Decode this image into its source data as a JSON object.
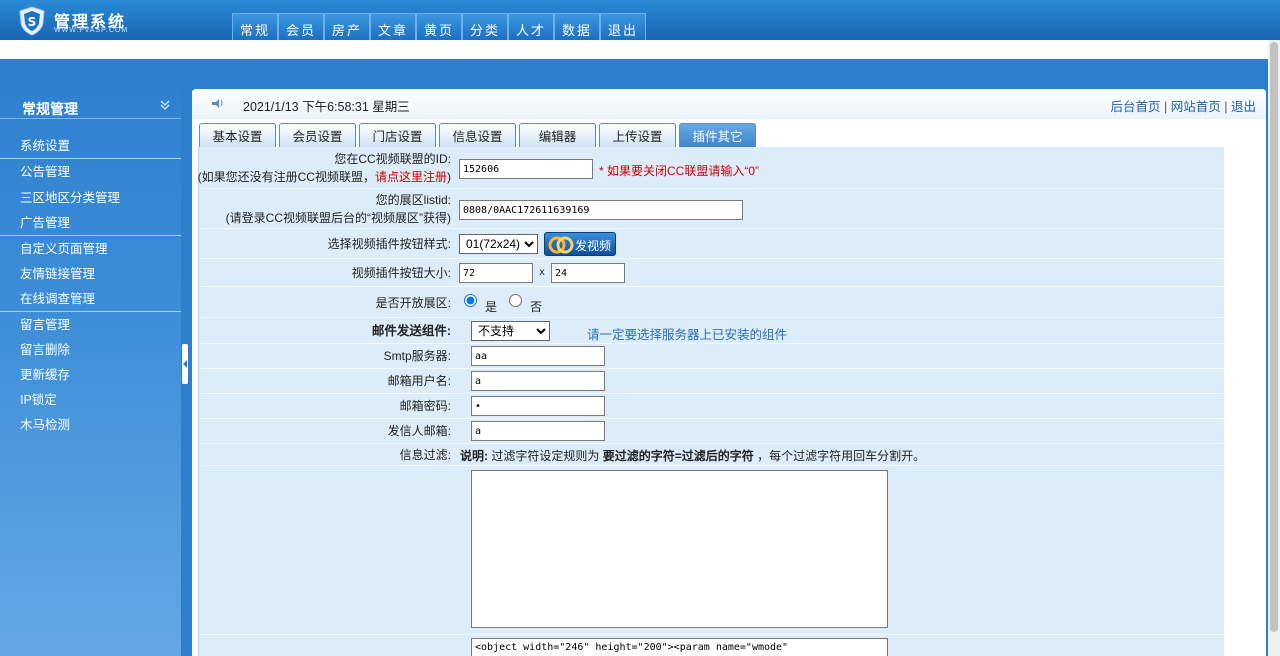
{
  "header": {
    "logo_title": "管理系统",
    "logo_subtitle": "WWW.FVASP.COM",
    "nav": [
      "常规",
      "会员",
      "房产",
      "文章",
      "黄页",
      "分类",
      "人才",
      "数据",
      "退出"
    ]
  },
  "sidebar": {
    "title": "常规管理",
    "items": [
      "系统设置",
      "公告管理",
      "三区地区分类管理",
      "广告管理",
      "自定义页面管理",
      "友情链接管理",
      "在线调查管理",
      "留言管理",
      "留言删除",
      "更新缓存",
      "IP锁定",
      "木马检测"
    ]
  },
  "main": {
    "datetime": "2021/1/13 下午6:58:31 星期三",
    "links": {
      "admin_home": "后台首页",
      "site_home": "网站首页",
      "logout": "退出",
      "sep": "|"
    },
    "tabs": [
      "基本设置",
      "会员设置",
      "门店设置",
      "信息设置",
      "编辑器",
      "上传设置",
      "插件其它"
    ],
    "active_tab": 6
  },
  "form": {
    "cc_id": {
      "label1": "您在CC视频联盟的ID:",
      "label2_pre": "(如果您还没有注册CC视频联盟，",
      "label2_link": "请点这里注册",
      "label2_post": ")",
      "value": "152606",
      "note": "* 如果要关闭CC联盟请输入“0”"
    },
    "listid": {
      "label1": "您的展区listid:",
      "label2": "(请登录CC视频联盟后台的“视频展区”获得)",
      "value": "0808/0AAC172611639169"
    },
    "button_style": {
      "label": "选择视频插件按钮样式:",
      "selected": "01(72x24)",
      "preview_text": "发视频"
    },
    "button_size": {
      "label": "视频插件按钮大小:",
      "width": "72",
      "x": "x",
      "height": "24"
    },
    "open_area": {
      "label": "是否开放展区:",
      "yes": "是",
      "no": "否"
    },
    "mail_component": {
      "label": "邮件发送组件:",
      "selected": "不支持",
      "hint": "请一定要选择服务器上已安装的组件"
    },
    "smtp": {
      "label": "Smtp服务器:",
      "value": "aa"
    },
    "mail_user": {
      "label": "邮箱用户名:",
      "value": "a"
    },
    "mail_pass": {
      "label": "邮箱密码:",
      "value": "•"
    },
    "sender": {
      "label": "发信人邮箱:",
      "value": "a"
    },
    "filter": {
      "label": "信息过滤:",
      "desc_bold": "说明:",
      "desc_text1": "过滤字符设定规则为",
      "desc_rule": "要过滤的字符=过滤后的字符",
      "desc_text2": "，每个过滤字符用回车分割开。",
      "value": ""
    },
    "code": {
      "value": "<object width=\"246\" height=\"200\"><param name=\"wmode\""
    }
  }
}
